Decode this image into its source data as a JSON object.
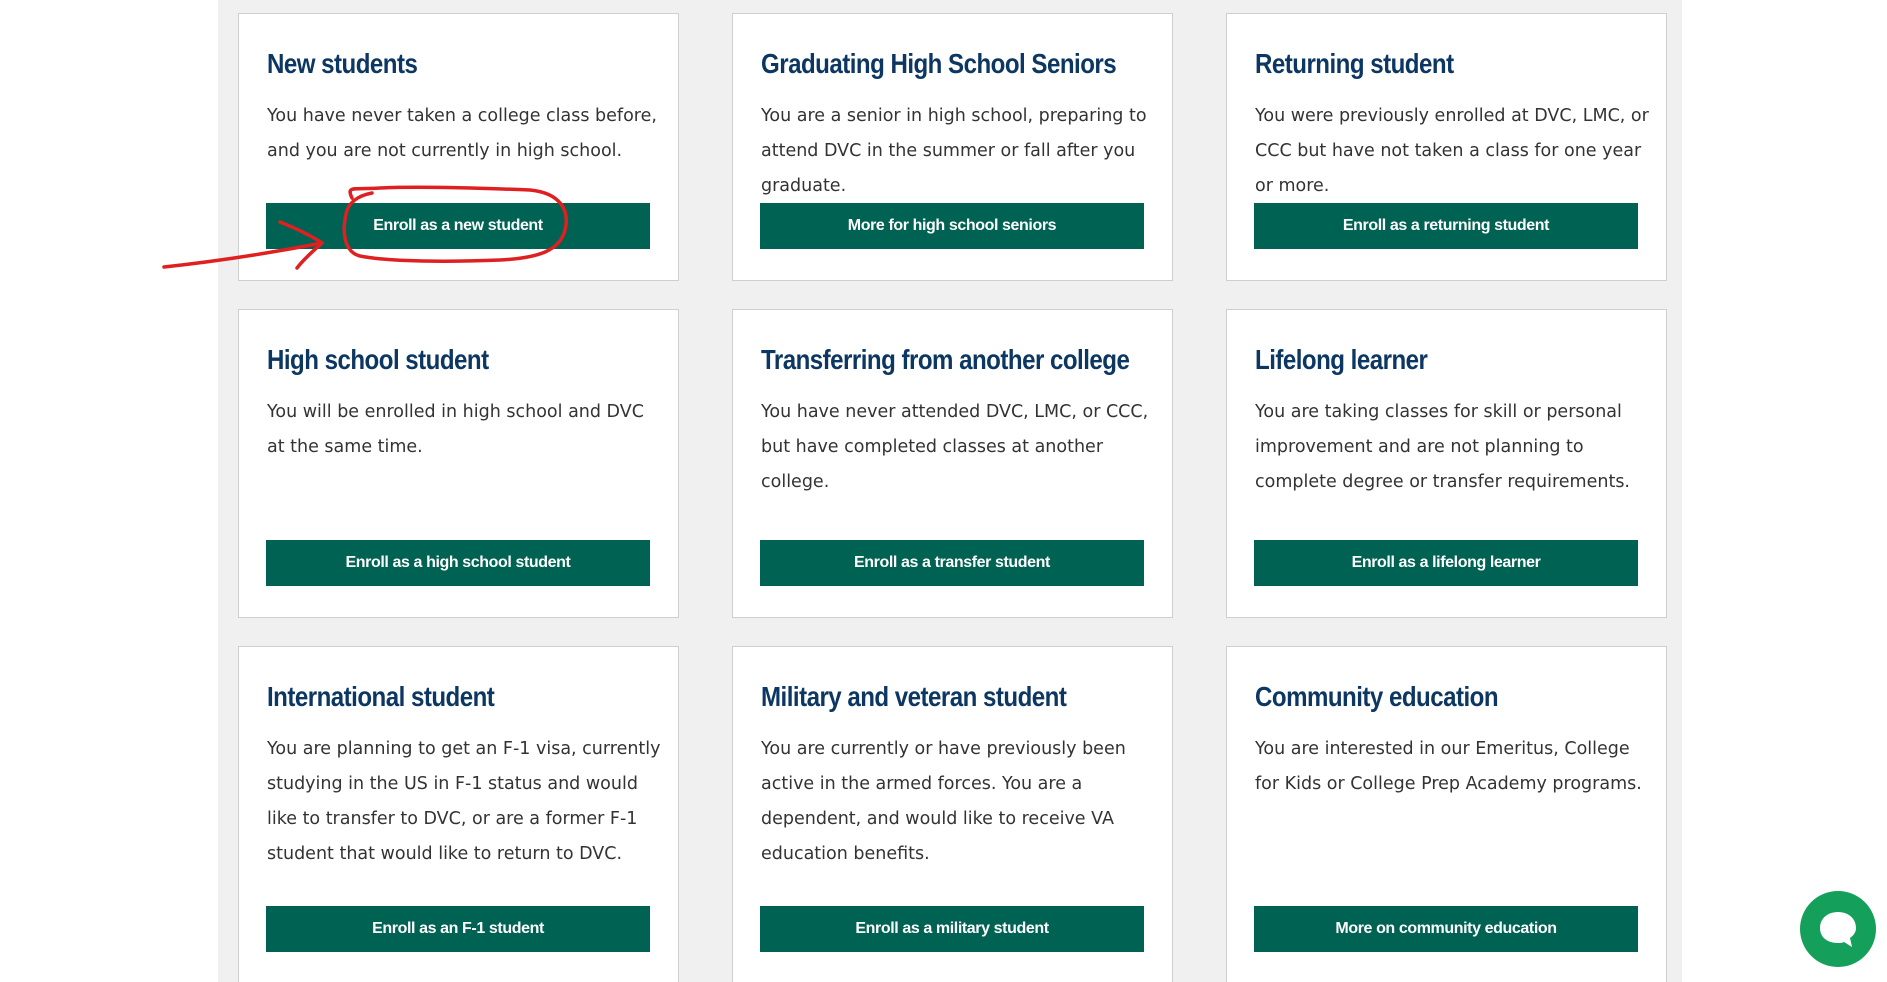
{
  "cards": [
    {
      "title": "New students",
      "description": "You have never taken a college class before, and you are not currently in high school.",
      "button": "Enroll as a new student"
    },
    {
      "title": "Graduating High School Seniors",
      "description": "You are a senior in high school, preparing to attend DVC in the summer or fall after you graduate.",
      "button": "More for high school seniors"
    },
    {
      "title": "Returning student",
      "description": "You were previously enrolled at DVC, LMC, or CCC but have not taken a class for one year or more.",
      "button": "Enroll as a returning student"
    },
    {
      "title": "High school student",
      "description": "You will be enrolled in high school and DVC at the same time.",
      "button": "Enroll as a high school student"
    },
    {
      "title": "Transferring from another college",
      "description": "You have never attended DVC, LMC, or CCC, but have completed classes at another college.",
      "button": "Enroll as a transfer student"
    },
    {
      "title": "Lifelong learner",
      "description": "You are taking classes for skill or personal improvement and are not planning to complete degree or transfer requirements.",
      "button": "Enroll as a lifelong learner"
    },
    {
      "title": "International student",
      "description": "You are planning to get an F-1 visa, currently studying in the US in F-1 status and would like to transfer to DVC, or are a former F-1 student that would like to return to DVC.",
      "button": "Enroll as an F-1 student"
    },
    {
      "title": "Military and veteran student",
      "description": "You are currently or have previously been active in the armed forces. You are a dependent, and would like to receive VA education benefits.",
      "button": "Enroll as a military student"
    },
    {
      "title": "Community education",
      "description": "You are interested in our Emeritus, College for Kids or College Prep Academy programs.",
      "button": "More on community education"
    }
  ],
  "colors": {
    "title": "#0d3763",
    "button_bg": "#006252",
    "page_band": "#f0f0f0",
    "chat_bubble": "#14a05a",
    "annotation": "#e02020"
  },
  "icons": {
    "chat": "chat-bubble-icon"
  }
}
